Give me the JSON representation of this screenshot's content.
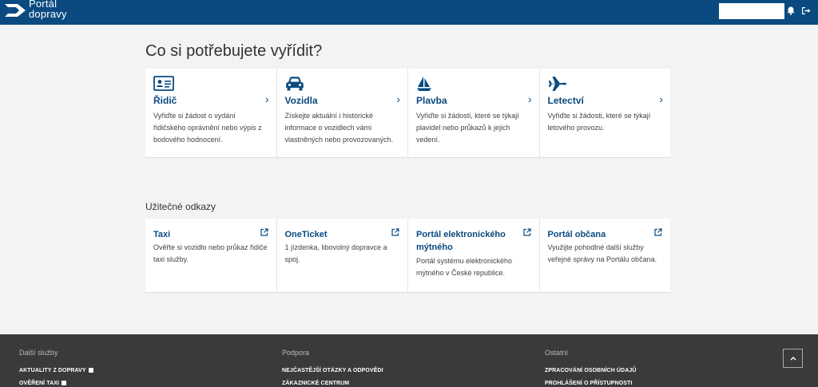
{
  "header": {
    "logo_line1": "Portál",
    "logo_line2": "dopravy",
    "search_value": ""
  },
  "main": {
    "title": "Co si potřebujete vyřídit?",
    "services": [
      {
        "icon": "driver-license-icon",
        "title": "Řidič",
        "desc": "Vyřiďte si žádost o vydání řidičského oprávnění nebo výpis z bodového hodnocení."
      },
      {
        "icon": "car-icon",
        "title": "Vozidla",
        "desc": "Získejte aktuální i historické informace o vozidlech vámi vlastněných nebo provozovaných."
      },
      {
        "icon": "sailboat-icon",
        "title": "Plavba",
        "desc": "Vyřiďte si žádosti, které se týkají plavidel nebo průkazů k jejich vedení."
      },
      {
        "icon": "airplane-icon",
        "title": "Letectví",
        "desc": "Vyřiďte si žádosti, které se týkají letového provozu."
      }
    ],
    "links_title": "Užitečné odkazy",
    "links": [
      {
        "title": "Taxi",
        "desc": "Ověřte si vozidlo nebo průkaz řidiče taxi služby."
      },
      {
        "title": "OneTicket",
        "desc": "1 jízdenka, libovolný dopravce a spoj."
      },
      {
        "title": "Portál elektronického mýtného",
        "desc": "Portál systému elektronického mýtného v České republice."
      },
      {
        "title": "Portál občana",
        "desc": "Využijte pohodlné další služby veřejné správy na Portálu občana."
      }
    ]
  },
  "footer": {
    "col1": {
      "heading": "Další služby",
      "items": [
        "Aktuality z dopravy",
        "Ověření taxi"
      ]
    },
    "col2": {
      "heading": "Podpora",
      "items": [
        "Nejčastější otázky a odpovědi",
        "Zákaznické centrum"
      ]
    },
    "col3": {
      "heading": "Ostatní",
      "items": [
        "Zpracování osobních údajů",
        "Prohlášení o přístupnosti"
      ]
    }
  },
  "colors": {
    "brand": "#0a4a80",
    "footer": "#3a3a3a",
    "background": "#f3f3f3"
  }
}
